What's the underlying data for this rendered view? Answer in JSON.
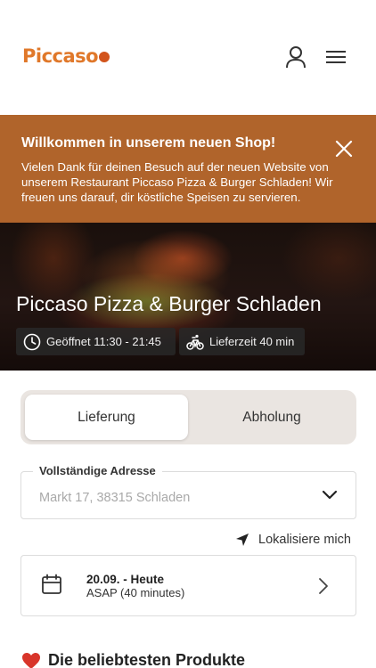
{
  "header": {
    "logo_text": "Piccaso",
    "user_icon": "user-icon",
    "menu_icon": "hamburger-menu-icon"
  },
  "banner": {
    "title": "Willkommen in unserem neuen Shop!",
    "text": "Vielen Dank für deinen Besuch auf der neuen Website von unserem Restaurant Piccaso Pizza & Burger Schladen! Wir freuen uns darauf, dir köstliche Speisen zu servieren.",
    "background": "#b0642b",
    "close_icon": "close-icon"
  },
  "hero": {
    "title": "Piccaso Pizza & Burger Schladen",
    "open_status": "Geöffnet 11:30 - 21:45",
    "delivery_time": "Lieferzeit 40 min",
    "open_icon": "clock-icon",
    "delivery_icon": "bicycle-icon"
  },
  "order_mode": {
    "options": [
      "Lieferung",
      "Abholung"
    ],
    "selected": "Lieferung"
  },
  "address": {
    "label": "Vollständige Adresse",
    "placeholder": "Markt 17, 38315 Schladen"
  },
  "locate": {
    "label": "Lokalisiere mich",
    "icon": "location-arrow-icon"
  },
  "schedule": {
    "date": "20.09. - Heute",
    "time": "ASAP (40 minutes)",
    "icon": "calendar-icon"
  },
  "popular": {
    "title": "Die beliebtesten Produkte",
    "icon": "heart-icon"
  },
  "colors": {
    "accent": "#b0642b",
    "logo": "#e0782a"
  }
}
